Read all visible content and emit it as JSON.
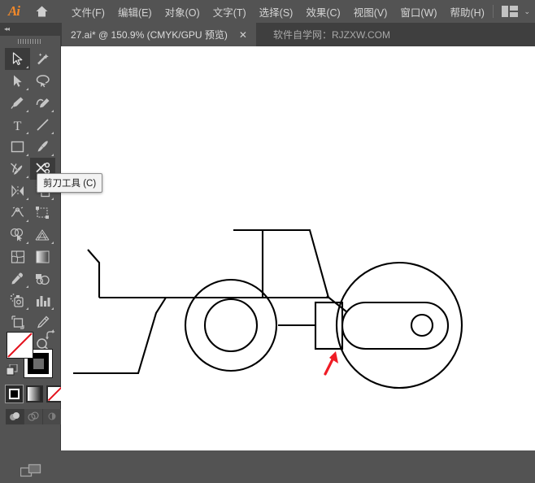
{
  "app": {
    "name": "Ai",
    "logo_color": "#f2892a",
    "home_icon": "home-icon"
  },
  "menubar": {
    "items": [
      {
        "label": "文件(F)",
        "name": "menu-file"
      },
      {
        "label": "编辑(E)",
        "name": "menu-edit"
      },
      {
        "label": "对象(O)",
        "name": "menu-object"
      },
      {
        "label": "文字(T)",
        "name": "menu-type"
      },
      {
        "label": "选择(S)",
        "name": "menu-select"
      },
      {
        "label": "效果(C)",
        "name": "menu-effect"
      },
      {
        "label": "视图(V)",
        "name": "menu-view"
      },
      {
        "label": "窗口(W)",
        "name": "menu-window"
      },
      {
        "label": "帮助(H)",
        "name": "menu-help"
      }
    ],
    "arrange_icon": "arrange-documents-icon",
    "chevron": "⌄"
  },
  "tabbar": {
    "document_title": "27.ai* @ 150.9% (CMYK/GPU 预览)",
    "close_label": "✕",
    "watermark": "软件自学网：RJZXW.COM",
    "collapse_arrows": "◂◂"
  },
  "toolbar": {
    "tooltip": "剪刀工具 (C)",
    "active_tool": "scissors-tool",
    "tools": [
      {
        "name": "selection-tool",
        "label": "选择工具",
        "row": 0,
        "col": 0,
        "active": true,
        "flyout": true
      },
      {
        "name": "magic-wand-tool",
        "label": "魔棒工具",
        "row": 0,
        "col": 1,
        "active": false,
        "flyout": false
      },
      {
        "name": "direct-selection-tool",
        "label": "直接选择工具",
        "row": 1,
        "col": 0,
        "active": false,
        "flyout": true
      },
      {
        "name": "lasso-tool",
        "label": "套索工具",
        "row": 1,
        "col": 1,
        "active": false,
        "flyout": false
      },
      {
        "name": "pen-tool",
        "label": "钢笔工具",
        "row": 2,
        "col": 0,
        "active": false,
        "flyout": true
      },
      {
        "name": "curvature-tool",
        "label": "曲率工具",
        "row": 2,
        "col": 1,
        "active": false,
        "flyout": true
      },
      {
        "name": "type-tool",
        "label": "文字工具",
        "row": 3,
        "col": 0,
        "active": false,
        "flyout": true
      },
      {
        "name": "line-segment-tool",
        "label": "直线段工具",
        "row": 3,
        "col": 1,
        "active": false,
        "flyout": true
      },
      {
        "name": "rectangle-tool",
        "label": "矩形工具",
        "row": 4,
        "col": 0,
        "active": false,
        "flyout": true
      },
      {
        "name": "paintbrush-tool",
        "label": "画笔工具",
        "row": 4,
        "col": 1,
        "active": false,
        "flyout": true
      },
      {
        "name": "blob-brush-tool",
        "label": "斑点画笔工具",
        "row": 5,
        "col": 0,
        "active": false,
        "flyout": true
      },
      {
        "name": "scissors-tool",
        "label": "剪刀工具",
        "row": 5,
        "col": 1,
        "active": true,
        "flyout": true
      },
      {
        "name": "rotate-tool",
        "label": "旋转工具",
        "row": 6,
        "col": 0,
        "active": false,
        "flyout": true
      },
      {
        "name": "scale-tool",
        "label": "比例缩放工具",
        "row": 6,
        "col": 1,
        "active": false,
        "flyout": true
      },
      {
        "name": "width-tool",
        "label": "宽度工具",
        "row": 7,
        "col": 0,
        "active": false,
        "flyout": true
      },
      {
        "name": "free-transform-tool",
        "label": "自由变换工具",
        "row": 7,
        "col": 1,
        "active": false,
        "flyout": false
      },
      {
        "name": "shape-builder-tool",
        "label": "形状生成器工具",
        "row": 8,
        "col": 0,
        "active": false,
        "flyout": true
      },
      {
        "name": "perspective-grid-tool",
        "label": "透视网格工具",
        "row": 8,
        "col": 1,
        "active": false,
        "flyout": true
      },
      {
        "name": "mesh-tool",
        "label": "网格工具",
        "row": 9,
        "col": 0,
        "active": false,
        "flyout": false
      },
      {
        "name": "gradient-tool",
        "label": "渐变工具",
        "row": 9,
        "col": 1,
        "active": false,
        "flyout": false
      },
      {
        "name": "eyedropper-tool",
        "label": "吸管工具",
        "row": 10,
        "col": 0,
        "active": false,
        "flyout": true
      },
      {
        "name": "blend-tool",
        "label": "混合工具",
        "row": 10,
        "col": 1,
        "active": false,
        "flyout": false
      },
      {
        "name": "symbol-sprayer-tool",
        "label": "符号喷枪工具",
        "row": 11,
        "col": 0,
        "active": false,
        "flyout": true
      },
      {
        "name": "column-graph-tool",
        "label": "柱形图工具",
        "row": 11,
        "col": 1,
        "active": false,
        "flyout": true
      },
      {
        "name": "artboard-tool",
        "label": "画板工具",
        "row": 12,
        "col": 0,
        "active": false,
        "flyout": false
      },
      {
        "name": "slice-tool",
        "label": "切片工具",
        "row": 12,
        "col": 1,
        "active": false,
        "flyout": true
      },
      {
        "name": "hand-tool",
        "label": "抓手工具",
        "row": 13,
        "col": 0,
        "active": false,
        "flyout": true
      },
      {
        "name": "zoom-tool",
        "label": "缩放工具",
        "row": 13,
        "col": 1,
        "active": false,
        "flyout": false
      }
    ],
    "fill_stroke": {
      "fill": "none",
      "fill_color": "#ffffff",
      "none_slash_color": "#e4131e",
      "stroke_color": "#000000",
      "swap_icon": "swap-fill-stroke-icon",
      "default_icon": "default-fill-stroke-icon"
    },
    "color_modes": [
      {
        "name": "color-mode-button",
        "selected": true
      },
      {
        "name": "gradient-mode-button",
        "selected": false
      },
      {
        "name": "none-mode-button",
        "selected": false
      }
    ],
    "draw_modes": [
      {
        "name": "draw-normal-mode",
        "selected": true
      },
      {
        "name": "draw-behind-mode",
        "selected": false
      },
      {
        "name": "draw-inside-mode",
        "selected": false
      }
    ],
    "screen_mode_icon": "change-screen-mode-icon"
  },
  "canvas": {
    "background": "#ffffff",
    "artwork_name": "tractor-line-drawing",
    "stroke_color": "#000000",
    "annotation_color": "#ef1c25",
    "annotation_name": "red-arrow-annotation",
    "shapes": [
      {
        "name": "cab-trapezoid",
        "type": "polyline"
      },
      {
        "name": "cab-divider",
        "type": "line"
      },
      {
        "name": "exhaust-pipe",
        "type": "polyline"
      },
      {
        "name": "tractor-body-hood",
        "type": "polyline"
      },
      {
        "name": "rear-fender-line",
        "type": "line"
      },
      {
        "name": "front-wheel-outer",
        "type": "circle"
      },
      {
        "name": "front-wheel-inner",
        "type": "circle"
      },
      {
        "name": "rear-wheel-circle",
        "type": "circle"
      },
      {
        "name": "axle-rectangle",
        "type": "rect"
      },
      {
        "name": "axle-connector",
        "type": "line"
      },
      {
        "name": "rounded-arm",
        "type": "rounded-rect"
      },
      {
        "name": "arm-hole-circle",
        "type": "circle"
      }
    ]
  }
}
